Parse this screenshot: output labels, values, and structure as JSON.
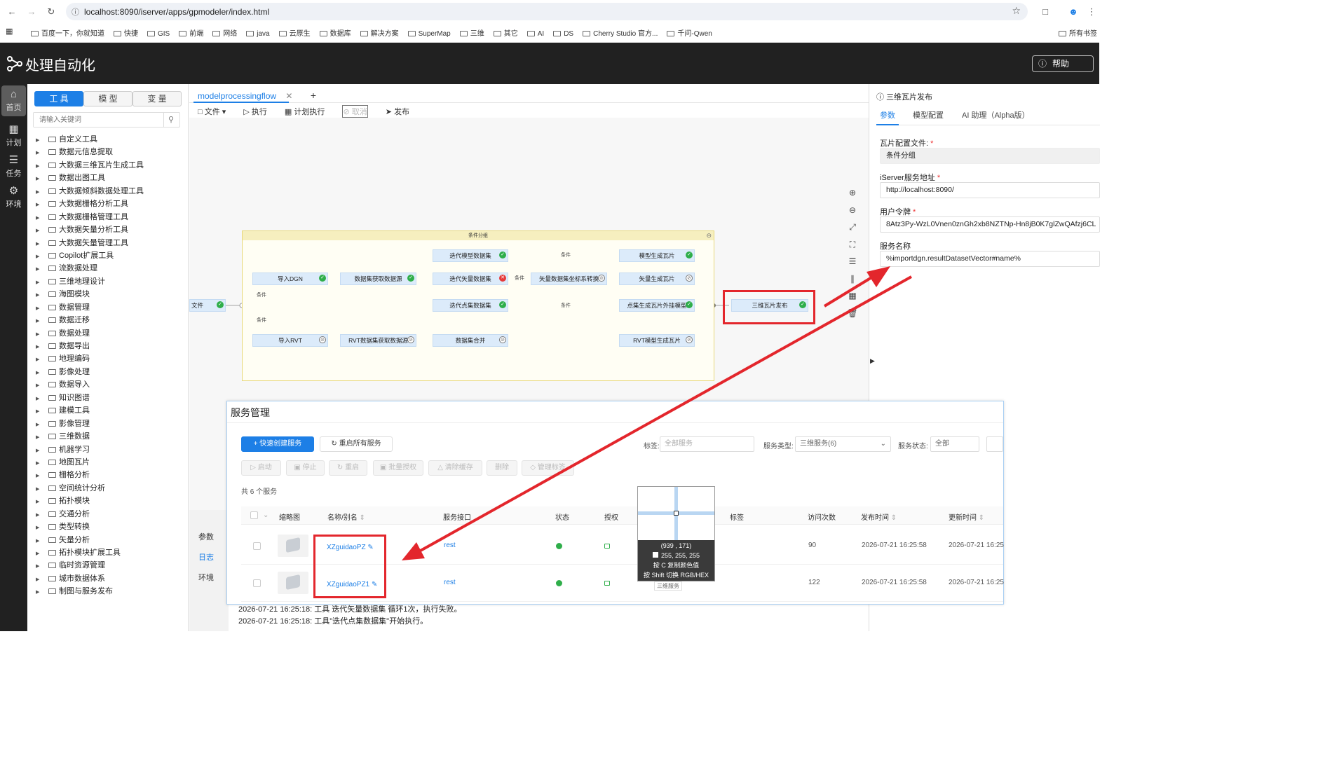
{
  "browser": {
    "url": "localhost:8090/iserver/apps/gpmodeler/index.html",
    "bookmarks": [
      "百度一下，你就知道",
      "快捷",
      "GIS",
      "前端",
      "网络",
      "java",
      "云原生",
      "数据库",
      "解决方案",
      "SuperMap",
      "三维",
      "其它",
      "AI",
      "DS",
      "Cherry Studio 官方...",
      "千问-Qwen"
    ],
    "all_bookmarks": "所有书签"
  },
  "app": {
    "title": "处理自动化",
    "help_label": "帮助"
  },
  "rail": [
    {
      "label": "首页",
      "icon": "home-icon",
      "active": true
    },
    {
      "label": "计划",
      "icon": "calendar-icon",
      "active": false
    },
    {
      "label": "任务",
      "icon": "task-icon",
      "active": false
    },
    {
      "label": "环境",
      "icon": "gear-icon",
      "active": false
    }
  ],
  "toolpanel": {
    "tabs": [
      "工 具",
      "模 型",
      "变 量"
    ],
    "search_placeholder": "请输入关键词",
    "tree": [
      "自定义工具",
      "数据元信息提取",
      "大数据三维瓦片生成工具",
      "数据出图工具",
      "大数据倾斜数据处理工具",
      "大数据栅格分析工具",
      "大数据栅格管理工具",
      "大数据矢量分析工具",
      "大数据矢量管理工具",
      "Copilot扩展工具",
      "流数据处理",
      "三维地理设计",
      "海图模块",
      "数据管理",
      "数据迁移",
      "数据处理",
      "数据导出",
      "地理编码",
      "影像处理",
      "数据导入",
      "知识图谱",
      "建模工具",
      "影像管理",
      "三维数据",
      "机器学习",
      "地图瓦片",
      "栅格分析",
      "空间统计分析",
      "拓扑模块",
      "交通分析",
      "类型转换",
      "矢量分析",
      "拓扑模块扩展工具",
      "临时资源管理",
      "城市数据体系",
      "制图与服务发布"
    ]
  },
  "editor": {
    "tab_label": "modelprocessingflow",
    "toolbar": {
      "file": "文件",
      "run": "执行",
      "schedule": "计划执行",
      "cancel": "取消",
      "publish": "发布"
    },
    "group_title": "条件分组",
    "nodes": {
      "file": "文件",
      "import_dgn": "导入DGN",
      "dataset_get": "数据集获取数据源",
      "iter_model": "迭代模型数据集",
      "iter_vector": "迭代矢量数据集",
      "iter_point": "迭代点集数据集",
      "vector_transform": "矢量数据集坐标系转换",
      "model_tile": "模型生成瓦片",
      "vector_tile": "矢量生成瓦片",
      "point_tile": "点集生成瓦片外挂模型",
      "import_rvt": "导入RVT",
      "rvt_get": "RVT数据集获取数据源",
      "merge": "数据集合并",
      "rvt_tile": "RVT模型生成瓦片",
      "publish_3d": "三维瓦片发布"
    },
    "edge_label": "条件",
    "bottom_tabs": [
      "参数",
      "日志",
      "环境"
    ],
    "log": [
      "2026-07-21 16:25:18:  工具 迭代矢量数据集 循环1次，执行失败。",
      "2026-07-21 16:25:18:  工具\"迭代点集数据集\"开始执行。"
    ]
  },
  "rightpanel": {
    "title": "三维瓦片发布",
    "tabs": [
      "参数",
      "模型配置",
      "AI 助理（Alpha版）"
    ],
    "fields": [
      {
        "label": "瓦片配置文件:",
        "value": "条件分组",
        "required": true
      },
      {
        "label": "iServer服务地址",
        "value": "http://localhost:8090/",
        "required": true
      },
      {
        "label": "用户令牌",
        "value": "8Atz3Py-WzL0Vnen0znGh2xb8NZTNp-Hn8jB0K7glZwQAfzj6CL",
        "required": true
      },
      {
        "label": "服务名称",
        "value": "%importdgn.resultDatasetVector#name%",
        "required": false
      }
    ]
  },
  "service_mgmt": {
    "title": "服务管理",
    "quick_create": "+ 快速创建服务",
    "restart_all": "重启所有服务",
    "filter_tag_label": "标签:",
    "filter_tag_placeholder": "全部服务",
    "filter_type_label": "服务类型:",
    "filter_type_value": "三维服务(6)",
    "filter_status_label": "服务状态:",
    "filter_status_value": "全部",
    "actions": [
      "启动",
      "停止",
      "重启",
      "批量授权",
      "清除缓存",
      "删除",
      "管理标签"
    ],
    "count_text": "共 6 个服务",
    "columns": [
      "缩略图",
      "名称/别名",
      "服务接口",
      "状态",
      "授权",
      "标签",
      "访问次数",
      "发布时间",
      "更新时间"
    ],
    "rows": [
      {
        "name": "XZguidaoPZ",
        "interface": "rest",
        "visits": "90",
        "published": "2026-07-21 16:25:58",
        "updated": "2026-07-21 16:25"
      },
      {
        "name": "XZguidaoPZ1",
        "interface": "rest",
        "visits": "122",
        "published": "2026-07-21 16:25:58",
        "updated": "2026-07-21 16:25"
      }
    ],
    "row2_tag": "三维服务"
  },
  "picker": {
    "coords": "(939 , 171)",
    "rgb": "255, 255, 255",
    "hint1": "按 C 复制颜色值",
    "hint2": "按 Shift 切换 RGB/HEX"
  },
  "colors": {
    "accent": "#1d7fe6",
    "header": "#212121",
    "highlight": "#e3262c",
    "ok": "#2fae4a",
    "error": "#e63a3a"
  }
}
